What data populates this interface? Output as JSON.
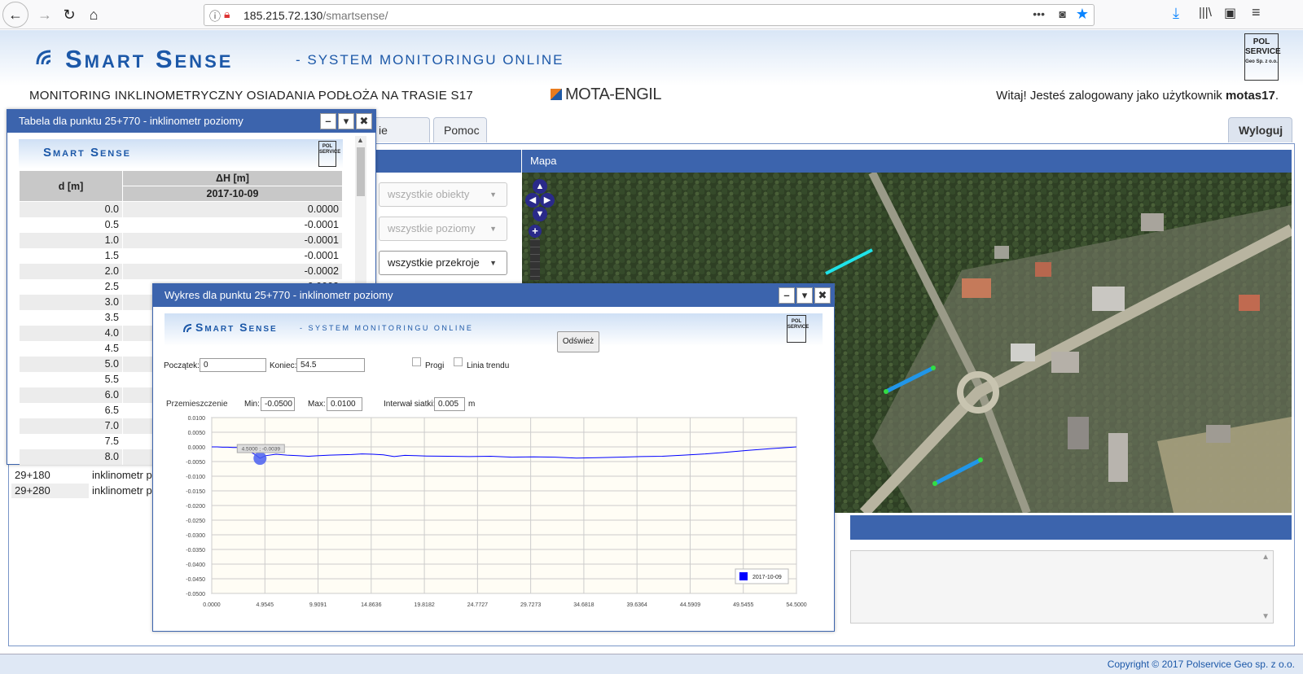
{
  "browser": {
    "url_host": "185.215.72.130",
    "url_path": "/smartsense/",
    "dots": "•••"
  },
  "header": {
    "logo": "Smart Sense",
    "logo_suffix": "- SYSTEM MONITORINGU ONLINE",
    "pol_logo_lines": [
      "POL",
      "SERVICE",
      "Geo Sp. z o.o."
    ],
    "project_title": "MONITORING INKLINOMETRYCZNY OSIADANIA PODŁOŻA NA TRASIE S17",
    "partner_logo": "MOTA-ENGIL",
    "welcome_prefix": "Witaj! Jesteś zalogowany jako użytkownik ",
    "username": "motas17",
    "welcome_suffix": "."
  },
  "tabs": [
    {
      "label": "ie plików"
    },
    {
      "label": "Pomoc"
    }
  ],
  "logout_label": "Wyloguj",
  "filters": {
    "objects": "wszystkie obiekty",
    "levels": "wszystkie poziomy",
    "sections": "wszystkie przekroje"
  },
  "point_list": [
    {
      "id": "29+180",
      "type": "inklinometr po"
    },
    {
      "id": "29+280",
      "type": "inklinometr po"
    }
  ],
  "map": {
    "title": "Mapa",
    "controls": {
      "up": "▲",
      "down": "▼",
      "left": "◀",
      "right": "▶",
      "zoom_in": "+"
    }
  },
  "footer": {
    "copyright": "Copyright © 2017 Polservice Geo sp. z o.o."
  },
  "table_dialog": {
    "title": "Tabela dla punktu 25+770 - inklinometr poziomy",
    "btn_min": "–",
    "btn_menu": "▾",
    "btn_close": "✖",
    "banner_logo": "Smart Sense",
    "col_depth": "d [m]",
    "col_delta": "ΔH [m]",
    "col_date": "2017-10-09",
    "rows": [
      [
        "0.0",
        "0.0000"
      ],
      [
        "0.5",
        "-0.0001"
      ],
      [
        "1.0",
        "-0.0001"
      ],
      [
        "1.5",
        "-0.0001"
      ],
      [
        "2.0",
        "-0.0002"
      ],
      [
        "2.5",
        "-0.0002"
      ],
      [
        "3.0",
        ""
      ],
      [
        "3.5",
        ""
      ],
      [
        "4.0",
        ""
      ],
      [
        "4.5",
        ""
      ],
      [
        "5.0",
        ""
      ],
      [
        "5.5",
        ""
      ],
      [
        "6.0",
        ""
      ],
      [
        "6.5",
        ""
      ],
      [
        "7.0",
        ""
      ],
      [
        "7.5",
        ""
      ],
      [
        "8.0",
        ""
      ]
    ]
  },
  "chart_dialog": {
    "title": "Wykres dla punktu 25+770 - inklinometr poziomy",
    "btn_min": "–",
    "btn_menu": "▾",
    "btn_close": "✖",
    "banner_logo": "Smart Sense",
    "banner_suffix": "- SYSTEM MONITORINGU ONLINE",
    "start_label": "Początek:",
    "start_value": "0",
    "end_label": "Koniec:",
    "end_value": "54.5",
    "thresholds_label": "Progi",
    "trend_label": "Linia trendu",
    "refresh_label": "Odśwież",
    "displacement_label": "Przemieszczenie",
    "min_label": "Min:",
    "min_value": "-0.0500",
    "max_label": "Max:",
    "max_value": "0.0100",
    "grid_label": "Interwał siatki:",
    "grid_value": "0.005",
    "grid_unit": "m",
    "tooltip": "4.5000 ; -0.0039"
  },
  "chart_data": {
    "type": "line",
    "title": "",
    "xlabel": "",
    "ylabel": "",
    "xlim": [
      0,
      54.5
    ],
    "ylim": [
      -0.05,
      0.01
    ],
    "x_ticks": [
      "0.0000",
      "4.9545",
      "9.9091",
      "14.8636",
      "19.8182",
      "24.7727",
      "29.7273",
      "34.6818",
      "39.6364",
      "44.5909",
      "49.5455",
      "54.5000"
    ],
    "y_ticks": [
      "0.0100",
      "0.0050",
      "0.0000",
      "-0.0050",
      "-0.0100",
      "-0.0150",
      "-0.0200",
      "-0.0250",
      "-0.0300",
      "-0.0350",
      "-0.0400",
      "-0.0450",
      "-0.0500"
    ],
    "grid": true,
    "legend": "bottom-right",
    "series": [
      {
        "name": "2017-10-09",
        "color": "#0000ff",
        "x": [
          0,
          0.5,
          1,
          1.5,
          2,
          2.5,
          3,
          4,
          4.5,
          5,
          6,
          7,
          8,
          9,
          10,
          11,
          12,
          13,
          14,
          15,
          16,
          17,
          18,
          19,
          20,
          22,
          24,
          26,
          28,
          30,
          32,
          34,
          36,
          38,
          40,
          42,
          44,
          46,
          48,
          50,
          52,
          53,
          54.5
        ],
        "y": [
          0,
          0,
          -0.0001,
          -0.0001,
          -0.0002,
          -0.0002,
          -0.0005,
          -0.0025,
          -0.0039,
          -0.003,
          -0.0025,
          -0.0028,
          -0.003,
          -0.0032,
          -0.003,
          -0.0028,
          -0.0027,
          -0.0026,
          -0.0024,
          -0.0025,
          -0.0027,
          -0.0033,
          -0.0029,
          -0.003,
          -0.0031,
          -0.0032,
          -0.0033,
          -0.0032,
          -0.0035,
          -0.0034,
          -0.0035,
          -0.0038,
          -0.0037,
          -0.0035,
          -0.0033,
          -0.0032,
          -0.0028,
          -0.0024,
          -0.0018,
          -0.0012,
          -0.0006,
          -0.0004,
          0
        ]
      }
    ]
  },
  "colors": {
    "accent": "#3c64ad",
    "brand": "#1c58a8",
    "series": "#0000ff",
    "marker_cyan": "#1fe3e8",
    "marker_blue": "#2196e8",
    "marker_green": "#33dd44"
  }
}
